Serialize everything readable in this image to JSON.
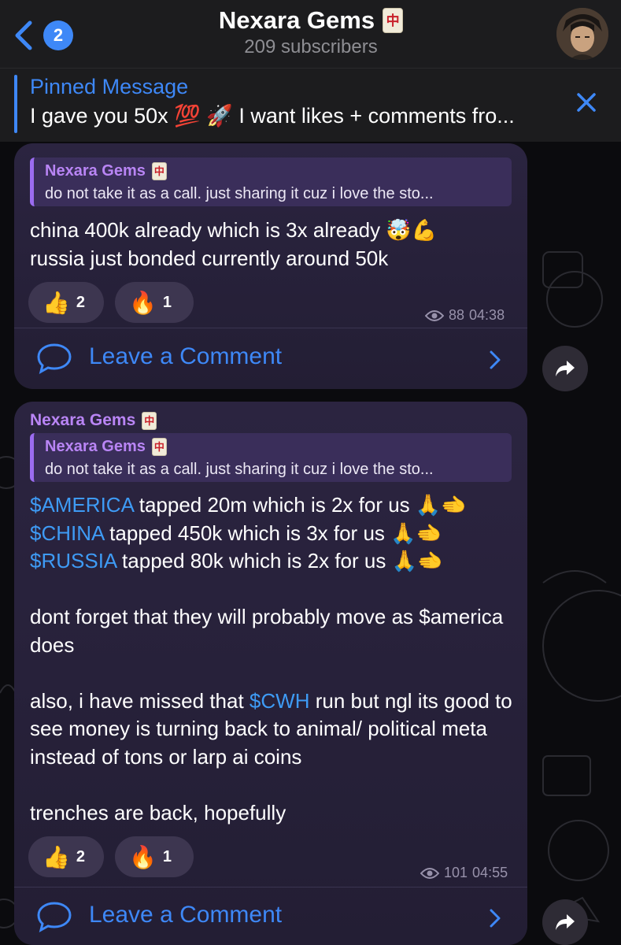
{
  "header": {
    "unread_count": "2",
    "title": "Nexara Gems",
    "title_icon": "mahjong-red-dragon",
    "subscribers": "209 subscribers"
  },
  "pinned": {
    "label": "Pinned Message",
    "text": "I gave you 50x 💯 🚀 I want likes + comments fro..."
  },
  "messages": [
    {
      "reply": {
        "author": "Nexara Gems",
        "text": "do not take it as a call. just sharing it cuz i love the sto..."
      },
      "lines": [
        "china 400k already which is 3x already 🤯💪",
        "russia just bonded currently around 50k"
      ],
      "reactions": [
        {
          "emoji": "👍",
          "count": "2"
        },
        {
          "emoji": "🔥",
          "count": "1"
        }
      ],
      "views": "88",
      "time": "04:38",
      "comment_label": "Leave a Comment"
    },
    {
      "sender": "Nexara Gems",
      "reply": {
        "author": "Nexara Gems",
        "text": "do not take it as a call. just sharing it cuz i love the sto..."
      },
      "rows": [
        {
          "tag": "$AMERICA",
          "rest": " tapped 20m which is 2x for us 🙏🫲"
        },
        {
          "tag": "$CHINA",
          "rest": " tapped 450k which is 3x for us 🙏🫲"
        },
        {
          "tag": "$RUSSIA",
          "rest": " tapped 80k which is 2x for us 🙏🫲"
        }
      ],
      "para1": "dont forget that they will probably move as $america does",
      "para2_pre": "also, i have missed that ",
      "para2_tag": "$CWH",
      "para2_post": " run but ngl its good to see money is turning back to animal/ political meta instead of tons or larp ai coins",
      "para3": "trenches are back, hopefully",
      "reactions": [
        {
          "emoji": "👍",
          "count": "2"
        },
        {
          "emoji": "🔥",
          "count": "1"
        }
      ],
      "views": "101",
      "time": "04:55",
      "comment_label": "Leave a Comment"
    }
  ]
}
